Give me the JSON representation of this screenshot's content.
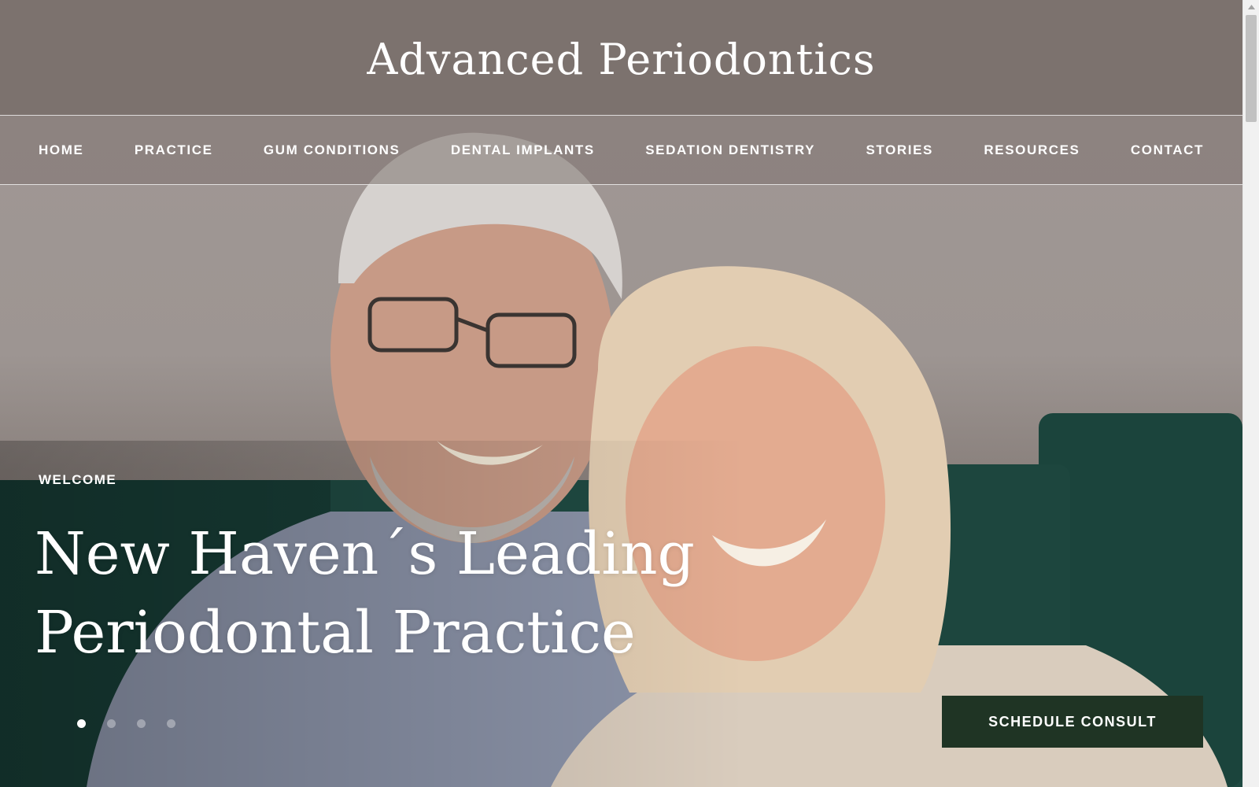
{
  "site": {
    "title": "Advanced Periodontics"
  },
  "nav": {
    "items": [
      {
        "label": "HOME"
      },
      {
        "label": "PRACTICE"
      },
      {
        "label": "GUM CONDITIONS"
      },
      {
        "label": "DENTAL IMPLANTS"
      },
      {
        "label": "SEDATION DENTISTRY"
      },
      {
        "label": "STORIES"
      },
      {
        "label": "RESOURCES"
      },
      {
        "label": "CONTACT"
      }
    ]
  },
  "hero": {
    "eyebrow": "WELCOME",
    "headline_line1": "New Haven´s Leading",
    "headline_line2": "Periodontal Practice",
    "slide_count": 4,
    "active_slide": 1,
    "photo_subject": "smiling older couple on green sofa"
  },
  "cta": {
    "label": "SCHEDULE CONSULT"
  },
  "colors": {
    "header_bg": "#7a706c",
    "cta_bg": "#1f3424",
    "text": "#ffffff",
    "sofa": "#1f4a42",
    "wall": "#a19895"
  }
}
